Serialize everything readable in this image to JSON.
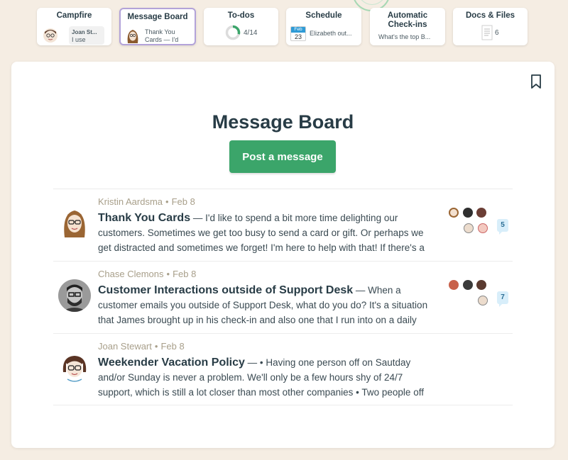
{
  "tools": [
    {
      "title": "Campfire",
      "preview_name": "Joan St...",
      "preview_text": "I use"
    },
    {
      "title": "Message Board",
      "preview_text": "Thank You Cards — I'd"
    },
    {
      "title": "To-dos",
      "progress": "4/14",
      "progress_fraction": 0.29
    },
    {
      "title": "Schedule",
      "cal_month": "Feb",
      "cal_day": "23",
      "preview_text": "Elizabeth out..."
    },
    {
      "title": "Automatic Check-ins",
      "preview_text": "What's the top B..."
    },
    {
      "title": "Docs & Files",
      "count": "6"
    }
  ],
  "page": {
    "title": "Message Board",
    "post_label": "Post a message"
  },
  "messages": [
    {
      "author": "Kristin Aardsma",
      "date": "Feb 8",
      "subject": "Thank You Cards",
      "excerpt": " — I'd like to spend a bit more time delighting our customers. Sometimes we get too busy to send a card or gift. Or perhaps we get distracted and sometimes we forget! I'm here to help with that! If there's a",
      "comments": "5"
    },
    {
      "author": "Chase Clemons",
      "date": "Feb 8",
      "subject": "Customer Interactions outside of Support Desk",
      "excerpt": " — When a customer emails you outside of Support Desk, what do you do? It's a situation that James brought up in his check-in and also one that I run into on a daily",
      "comments": "7"
    },
    {
      "author": "Joan Stewart",
      "date": "Feb 8",
      "subject": "Weekender Vacation Policy",
      "excerpt": " — • Having one person off on Sautday and/or Sunday is never a problem. We'll only be a few hours shy of 24/7 support, which is still a lot closer than most other companies • Two people off",
      "comments": ""
    }
  ],
  "meta_separator": "•",
  "colors": {
    "background": "#f5ede3",
    "accent_green": "#3ba56a",
    "active_tool_border": "#b3a3d9",
    "meta_text": "#a89f8a",
    "comment_badge": "#d8eefa"
  }
}
